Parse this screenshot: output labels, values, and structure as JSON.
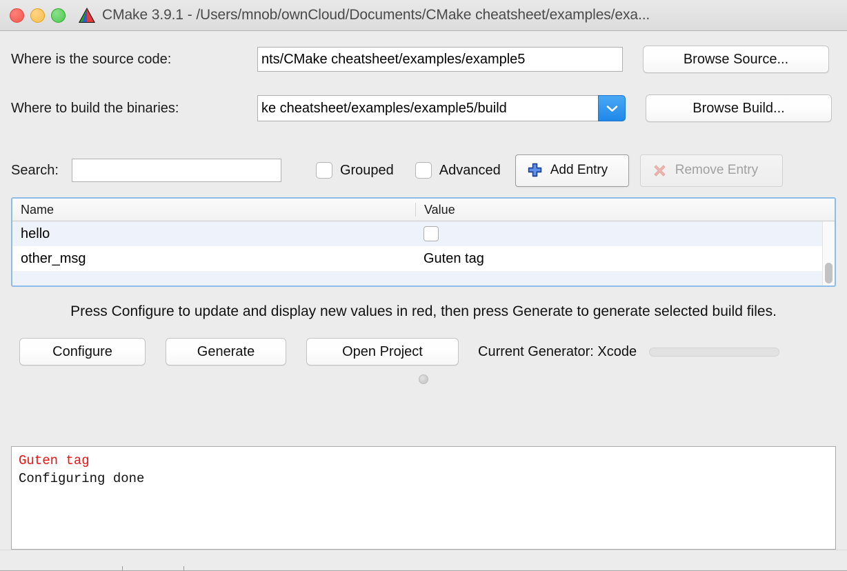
{
  "window": {
    "title": "CMake 3.9.1 - /Users/mnob/ownCloud/Documents/CMake cheatsheet/examples/exa...",
    "traffic": {
      "close": "close-button",
      "minimize": "minimize-button",
      "zoom": "zoom-button"
    }
  },
  "source": {
    "label": "Where is the source code:",
    "value": "nts/CMake cheatsheet/examples/example5",
    "browse_label": "Browse Source..."
  },
  "build": {
    "label": "Where to build the binaries:",
    "value": "ke cheatsheet/examples/example5/build",
    "browse_label": "Browse Build...",
    "dropdown_color": "#2089e8"
  },
  "search": {
    "label": "Search:",
    "value": "",
    "placeholder": ""
  },
  "options": {
    "grouped_label": "Grouped",
    "grouped_checked": false,
    "advanced_label": "Advanced",
    "advanced_checked": false,
    "add_entry_label": "Add Entry",
    "remove_entry_label": "Remove Entry",
    "remove_entry_disabled": true
  },
  "cache_table": {
    "columns": [
      "Name",
      "Value"
    ],
    "rows": [
      {
        "name": "hello",
        "value": "",
        "value_type": "checkbox",
        "checked": false,
        "selected": true
      },
      {
        "name": "other_msg",
        "value": "Guten tag",
        "value_type": "text",
        "checked": false,
        "selected": false
      }
    ]
  },
  "hint": {
    "line1": "Press Configure to update and display new values in red, then press Generate to generate",
    "line2": "selected build files."
  },
  "actions": {
    "configure_label": "Configure",
    "generate_label": "Generate",
    "open_project_label": "Open Project",
    "generator_label": "Current Generator: Xcode",
    "progress_percent": 0
  },
  "log": {
    "lines": [
      {
        "text": "Guten tag",
        "color": "#ee1111"
      },
      {
        "text": "Configuring done",
        "color": "#111111"
      }
    ]
  }
}
